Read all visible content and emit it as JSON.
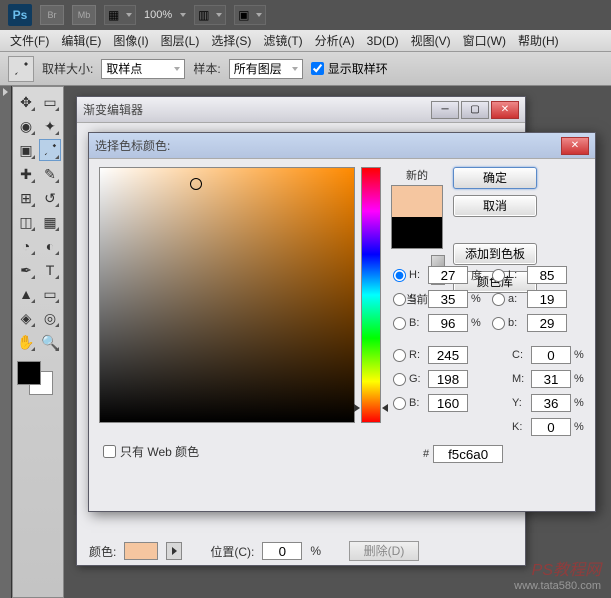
{
  "app": {
    "ps_label": "Ps",
    "br": "Br",
    "mb": "Mb",
    "zoom": "100%"
  },
  "menu": [
    "文件(F)",
    "编辑(E)",
    "图像(I)",
    "图层(L)",
    "选择(S)",
    "滤镜(T)",
    "分析(A)",
    "3D(D)",
    "视图(V)",
    "窗口(W)",
    "帮助(H)"
  ],
  "options": {
    "sample_size_label": "取样大小:",
    "sample_size_value": "取样点",
    "sample_label": "样本:",
    "sample_value": "所有图层",
    "show_ring": "显示取样环"
  },
  "win_gradient": {
    "title": "渐变编辑器",
    "color_label": "颜色:",
    "pos_label": "位置(C):",
    "pos_value": "0",
    "pos_unit": "%",
    "delete_btn": "删除(D)"
  },
  "win_cp": {
    "title": "选择色标颜色:",
    "new_label": "新的",
    "cur_label": "当前",
    "btn_ok": "确定",
    "btn_cancel": "取消",
    "btn_add": "添加到色板",
    "btn_lib": "颜色库",
    "H": {
      "l": "H:",
      "v": "27",
      "u": "度"
    },
    "S": {
      "l": "S:",
      "v": "35",
      "u": "%"
    },
    "Bv": {
      "l": "B:",
      "v": "96",
      "u": "%"
    },
    "R": {
      "l": "R:",
      "v": "245",
      "u": ""
    },
    "G": {
      "l": "G:",
      "v": "198",
      "u": ""
    },
    "Bb": {
      "l": "B:",
      "v": "160",
      "u": ""
    },
    "L": {
      "l": "L:",
      "v": "85"
    },
    "a": {
      "l": "a:",
      "v": "19"
    },
    "b": {
      "l": "b:",
      "v": "29"
    },
    "C": {
      "l": "C:",
      "v": "0",
      "u": "%"
    },
    "M": {
      "l": "M:",
      "v": "31",
      "u": "%"
    },
    "Y": {
      "l": "Y:",
      "v": "36",
      "u": "%"
    },
    "K": {
      "l": "K:",
      "v": "0",
      "u": "%"
    },
    "hex_label": "#",
    "hex": "f5c6a0",
    "webonly": "只有 Web 颜色"
  },
  "watermark": {
    "cn": "PS教程网",
    "url": "www.tata580.com"
  }
}
